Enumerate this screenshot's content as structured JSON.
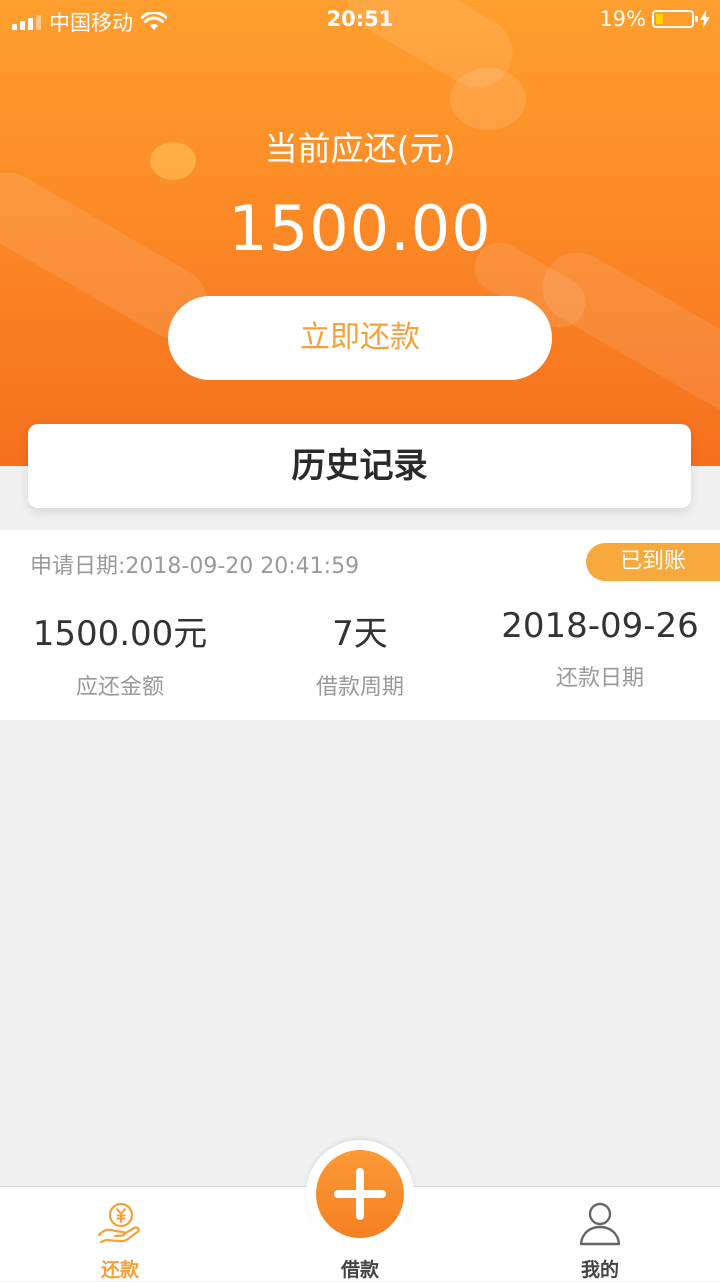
{
  "status_bar": {
    "carrier": "中国移动",
    "time": "20:51",
    "battery_percent": "19%"
  },
  "header": {
    "due_label": "当前应还(元)",
    "due_amount": "1500.00",
    "repay_button": "立即还款"
  },
  "history": {
    "title": "历史记录"
  },
  "record": {
    "apply_date": "申请日期:2018-09-20 20:41:59",
    "status": "已到账",
    "amount_value": "1500.00元",
    "amount_label": "应还金额",
    "period_value": "7天",
    "period_label": "借款周期",
    "repay_date_value": "2018-09-26",
    "repay_date_label": "还款日期"
  },
  "tabbar": {
    "tabs": [
      {
        "label": "还款",
        "icon": "repay-hand-yen-icon",
        "active": true
      },
      {
        "label": "借款",
        "icon": "plus-icon",
        "active": false
      },
      {
        "label": "我的",
        "icon": "user-icon",
        "active": false
      }
    ]
  },
  "colors": {
    "accent": "#f6a03a",
    "header_top": "#ff9f2e",
    "header_bottom": "#f56f1e"
  }
}
